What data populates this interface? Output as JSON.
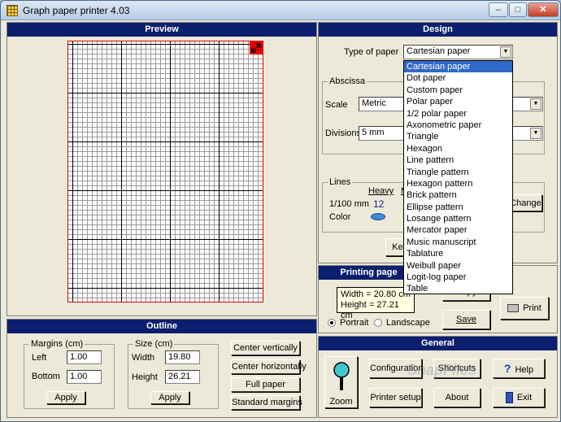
{
  "window": {
    "title": "Graph paper printer 4.03",
    "minimize": "–",
    "maximize": "□",
    "close": "✕"
  },
  "preview": {
    "header": "Preview"
  },
  "outline": {
    "header": "Outline",
    "margins": {
      "label": "Margins (cm)",
      "left_label": "Left",
      "left_value": "1.00",
      "bottom_label": "Bottom",
      "bottom_value": "1.00",
      "apply": "Apply"
    },
    "size": {
      "label": "Size (cm)",
      "width_label": "Width",
      "width_value": "19.80",
      "height_label": "Height",
      "height_value": "26.21",
      "apply": "Apply"
    },
    "buttons": {
      "center_v": "Center vertically",
      "center_h": "Center horizontally",
      "full": "Full paper",
      "standard": "Standard margins"
    }
  },
  "design": {
    "header": "Design",
    "type_label": "Type of paper",
    "type_value": "Cartesian paper",
    "abscissa": {
      "label": "Abscissa",
      "scale_label": "Scale",
      "scale_value": "Metric",
      "divisions_label": "Divisions",
      "divisions_value": "5 mm"
    },
    "lines": {
      "label": "Lines",
      "heavy": "Heavy",
      "partial": "M",
      "unit": "1/100 mm",
      "heavy_value": "12",
      "color_label": "Color",
      "change": "Change"
    },
    "partial_button": "Ke",
    "options": [
      "Cartesian paper",
      "Dot paper",
      "Custom paper",
      "Polar paper",
      "1/2 polar paper",
      "Axonometric paper",
      "Triangle",
      "Hexagon",
      "Line pattern",
      "Triangle pattern",
      "Hexagon pattern",
      "Brick pattern",
      "Ellipse pattern",
      "Losange pattern",
      "Mercator paper",
      "Music manuscript",
      "Tablature",
      "Weibull paper",
      "Logit-log paper",
      "Table"
    ]
  },
  "printing": {
    "header": "Printing page",
    "copy": "Copy",
    "save": "Save",
    "print": "Print",
    "portrait": "Portrait",
    "landscape": "Landscape",
    "tooltip_width": "Width = 20.80 cm",
    "tooltip_height": "Height = 27.21 cm"
  },
  "general": {
    "header": "General",
    "zoom": "Zoom",
    "configuration": "Configuration",
    "shortcuts": "Shortcuts",
    "help": "Help",
    "printer_setup": "Printer setup",
    "about": "About",
    "exit": "Exit",
    "watermark": "SnapFiles"
  }
}
